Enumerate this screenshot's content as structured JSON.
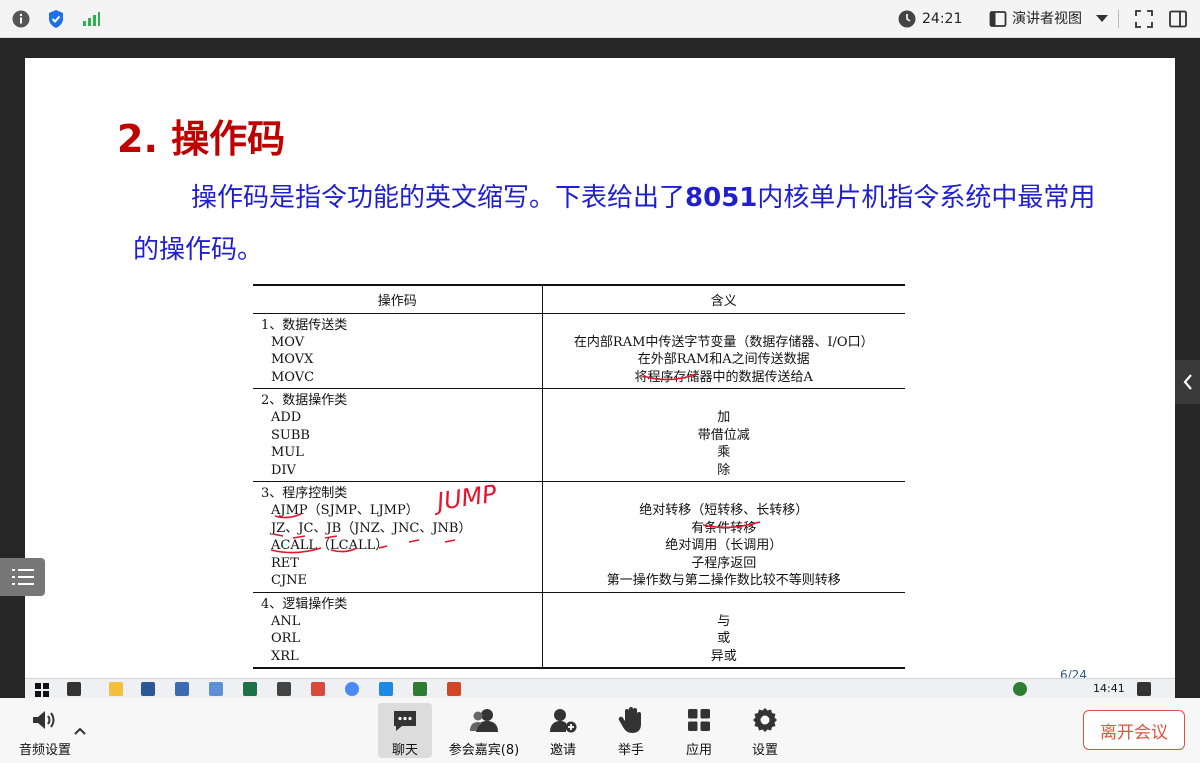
{
  "topbar": {
    "time": "24:21",
    "view_label": "演讲者视图"
  },
  "slide": {
    "title": "2. 操作码",
    "para_part1": "操作码是指令功能的英文缩写。下表给出了",
    "para_bold": "8051",
    "para_part2": "内核单片机指令系统中最常用的操作码。",
    "page_number": "6/24",
    "annotation": "JUMP",
    "table": {
      "head_op": "操作码",
      "head_meaning": "含义",
      "groups": [
        {
          "category": "1、数据传送类",
          "ops": [
            "MOV",
            "MOVX",
            "MOVC"
          ],
          "meanings": [
            "在内部RAM中传送字节变量（数据存储器、I/O口）",
            "在外部RAM和A之间传送数据",
            "将程序存储器中的数据传送给A"
          ]
        },
        {
          "category": "2、数据操作类",
          "ops": [
            "ADD",
            "SUBB",
            "MUL",
            "DIV"
          ],
          "meanings": [
            "加",
            "带借位减",
            "乘",
            "除"
          ]
        },
        {
          "category": "3、程序控制类",
          "ops": [
            "AJMP（SJMP、LJMP）",
            "JZ、JC、JB（JNZ、JNC、JNB）",
            "ACALL（LCALL）",
            "RET",
            "CJNE"
          ],
          "meanings": [
            "绝对转移（短转移、长转移）",
            "有条件转移",
            "绝对调用（长调用）",
            "子程序返回",
            "第一操作数与第二操作数比较不等则转移"
          ]
        },
        {
          "category": "4、逻辑操作类",
          "ops": [
            "ANL",
            "ORL",
            "XRL"
          ],
          "meanings": [
            "与",
            "或",
            "异或"
          ]
        }
      ]
    }
  },
  "taskbar": {
    "clock": "14:41"
  },
  "toolbar": {
    "audio": "音频设置",
    "chat": "聊天",
    "participants": "参会嘉宾(8)",
    "invite": "邀请",
    "raise_hand": "举手",
    "apps": "应用",
    "settings": "设置",
    "leave": "离开会议"
  }
}
